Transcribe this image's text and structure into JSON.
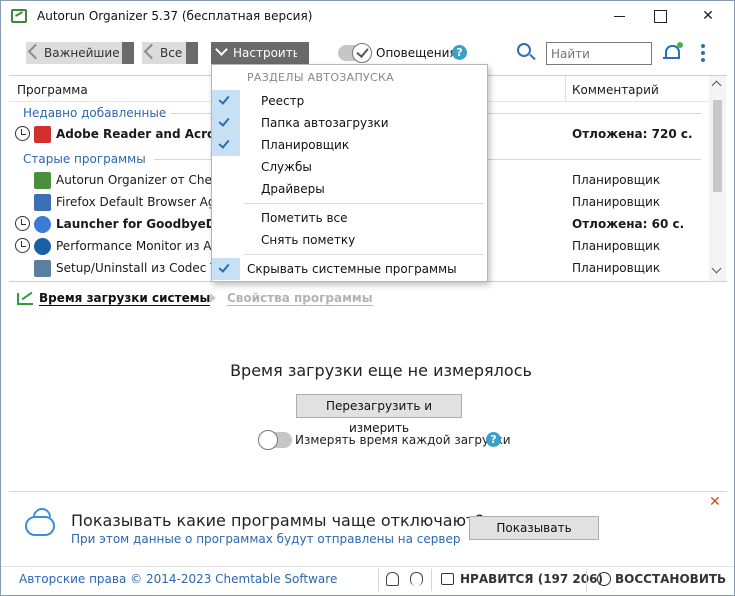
{
  "window": {
    "title": "Autorun Organizer 5.37 (бесплатная версия)"
  },
  "toolbar": {
    "back_important": "Важнейшие",
    "back_all": "Все",
    "setup": "Настроить",
    "notifications_label": "Оповещения",
    "search_placeholder": "Найти"
  },
  "list": {
    "col_program": "Программа",
    "col_comment": "Комментарий",
    "groups": [
      {
        "label": "Недавно добавленные"
      },
      {
        "label": "Старые программы"
      }
    ],
    "rows": [
      {
        "name": "Adobe Reader and Acrobat Manager",
        "comment": "Отложена: 720 с.",
        "bold": true,
        "delayed": true,
        "icon_color": "#d32f2f",
        "icon": "adobe-icon"
      },
      {
        "name": "Autorun Organizer от Chemtable",
        "comment": "Планировщик",
        "bold": false,
        "delayed": false,
        "icon_color": "#4a8f3a",
        "icon": "autorun-icon"
      },
      {
        "name": "Firefox Default Browser Agent",
        "comment": "Планировщик",
        "bold": false,
        "delayed": false,
        "icon_color": "#3b6fb6",
        "icon": "firefox-agent-icon"
      },
      {
        "name": "Launcher for GoodbyeDPI от",
        "comment": "Отложена: 60 с.",
        "bold": true,
        "delayed": true,
        "icon_color": "#3a7bd5",
        "icon": "goodbyedpi-icon"
      },
      {
        "name": "Performance Monitor из Advanced",
        "comment": "Планировщик",
        "bold": false,
        "delayed": true,
        "icon_color": "#1a5fa8",
        "icon": "performance-monitor-icon"
      },
      {
        "name": "Setup/Uninstall из Codec Tweak",
        "comment": "Планировщик",
        "bold": false,
        "delayed": false,
        "icon_color": "#5a7fa0",
        "icon": "setup-icon"
      }
    ]
  },
  "menu": {
    "header": "РАЗДЕЛЫ АВТОЗАПУСКА",
    "sections": [
      {
        "label": "Реестр",
        "checked": true
      },
      {
        "label": "Папка автозагрузки",
        "checked": true
      },
      {
        "label": "Планировщик",
        "checked": true
      },
      {
        "label": "Службы",
        "checked": false
      },
      {
        "label": "Драйверы",
        "checked": false
      }
    ],
    "mark_all": "Пометить все",
    "unmark": "Снять пометку",
    "hide_system": "Скрывать системные программы",
    "hide_system_checked": true
  },
  "tabs": {
    "boot_time": "Время загрузки системы",
    "program_props": "Свойства программы"
  },
  "boot": {
    "message": "Время загрузки еще не измерялось",
    "restart_button": "Перезагрузить и измерить",
    "measure_each": "Измерять время каждой загрузки"
  },
  "promo": {
    "title": "Показывать какие программы чаще отключают?",
    "subtitle": "При этом данные о программах будут отправлены на сервер",
    "button": "Показывать",
    "close": "✕"
  },
  "status": {
    "copyright": "Авторские права © 2014-2023 Chemtable Software",
    "like": "НРАВИТСЯ (197 206)",
    "restore": "ВОССТАНОВИТЬ"
  },
  "colors": {
    "accent": "#2c67b1",
    "menu_check_bg": "#c8e0f4",
    "help": "#3aa0c8"
  }
}
